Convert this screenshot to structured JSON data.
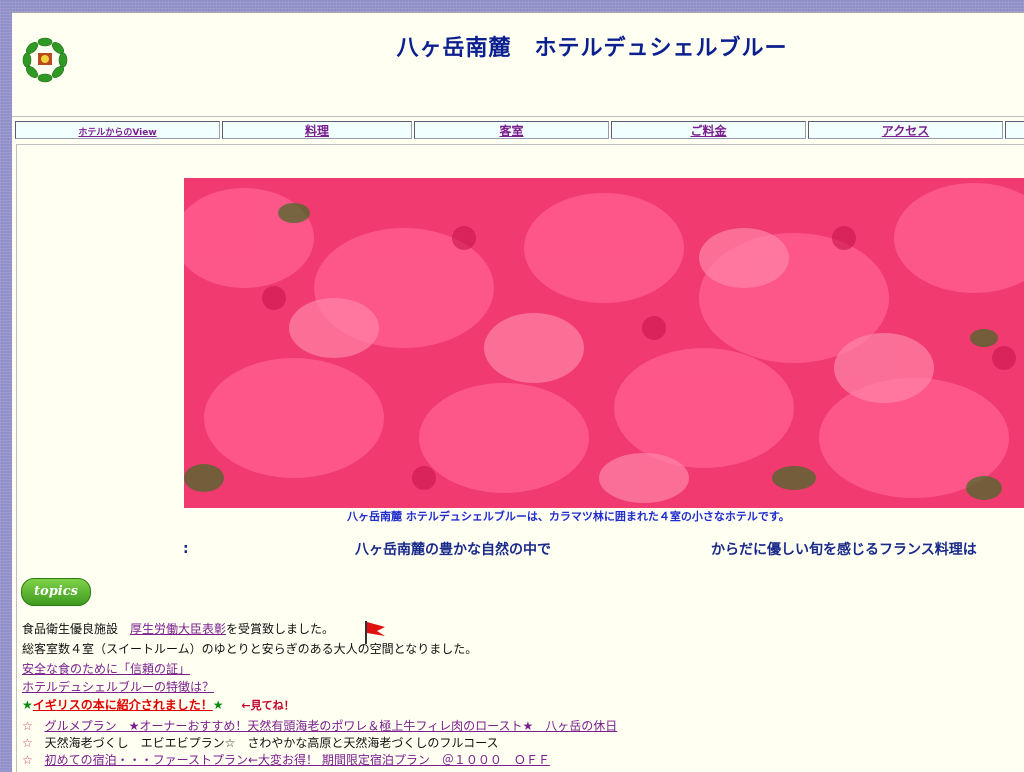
{
  "header": {
    "title": "八ヶ岳南麓　ホテルデュシェルブルー",
    "logo_icon": "wreath-logo-icon"
  },
  "nav": {
    "items": [
      {
        "label": "ホテルからのView"
      },
      {
        "label": "料理"
      },
      {
        "label": "客室"
      },
      {
        "label": "ご料金"
      },
      {
        "label": "アクセス"
      }
    ]
  },
  "hero": {
    "image": "pink-azalea-flowers-photo",
    "caption": "八ヶ岳南麓 ホテルデュシェルブルーは、カラマツ林に囲まれた４室の小さなホテルです。"
  },
  "tagline": {
    "colon": ":",
    "part1": "八ヶ岳南麓の豊かな自然の中で",
    "part2": "からだに優しい旬を感じるフランス料理は"
  },
  "topics": {
    "badge": "topics",
    "award_prefix": "食品衛生優良施設　",
    "award_link": "厚生労働大臣表彰",
    "award_suffix": "を受賞致しました。",
    "rooms_text": "総客室数４室（スイートルーム）のゆとりと安らぎのある大人の空間となりました。",
    "trust_link": "安全な食のために「信頼の証」",
    "features_link": "ホテルデュシェルブルーの特徴は？",
    "uk_star_left": "★",
    "uk_link": "イギリスの本に紹介されました！",
    "uk_star_right": "★",
    "uk_note": "←見てね！",
    "plans": [
      {
        "star": "☆",
        "text": "グルメプラン　★オーナーおすすめ！天然有頭海老のポワレ＆極上牛フィレ肉のロースト★　八ヶ岳の休日",
        "link": true
      },
      {
        "star": "☆",
        "text": "天然海老づくし　エビエビプラン☆　さわやかな高原と天然海老づくしのフルコース",
        "link": false
      },
      {
        "star": "☆",
        "text": "初めての宿泊・・・ファーストプラン←大変お得！ 期間限定宿泊プラン　＠１０００　ＯＦＦ",
        "link": true
      }
    ]
  },
  "colors": {
    "page_bg": "#fffff2",
    "title_color": "#0b1f8f",
    "link_color": "#7b1f8f",
    "caption_color": "#1f2bd0"
  }
}
